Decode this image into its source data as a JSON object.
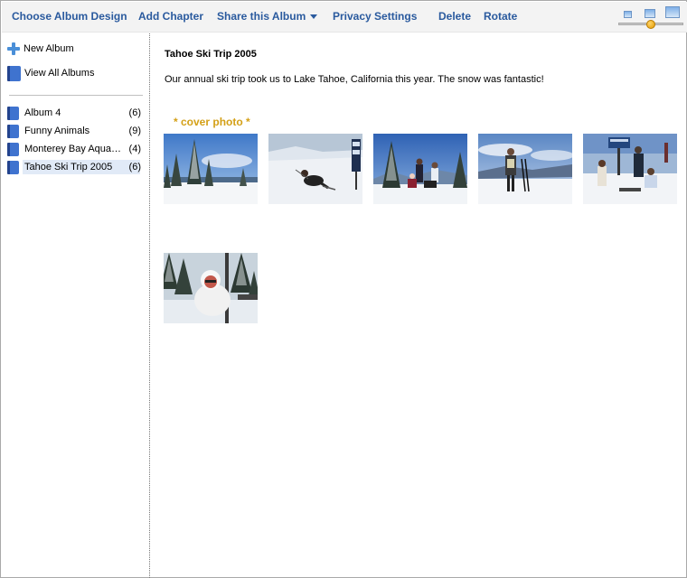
{
  "toolbar": {
    "choose_design": "Choose Album Design",
    "add_chapter": "Add Chapter",
    "share": "Share this Album",
    "privacy": "Privacy Settings",
    "delete": "Delete",
    "rotate": "Rotate",
    "thumbnail_size_level": 0.5
  },
  "sidebar": {
    "new_album": "New Album",
    "view_all": "View All Albums",
    "albums": [
      {
        "name": "Album 4",
        "count": "(6)"
      },
      {
        "name": "Funny Animals",
        "count": "(9)"
      },
      {
        "name": "Monterey Bay Aquarium",
        "count": "(4)"
      },
      {
        "name": "Tahoe Ski Trip 2005",
        "count": "(6)",
        "selected": true
      }
    ]
  },
  "main": {
    "title": "Tahoe Ski Trip 2005",
    "description": "Our annual ski trip took us to Lake Tahoe, California this year. The snow was fantastic!",
    "cover_label": "* cover photo *",
    "photos": [
      {
        "icon": "snowy-trees-photo"
      },
      {
        "icon": "skier-fallen-photo"
      },
      {
        "icon": "group-snow-photo"
      },
      {
        "icon": "skier-standing-photo"
      },
      {
        "icon": "family-sign-photo"
      },
      {
        "icon": "chairlift-photo"
      }
    ]
  }
}
